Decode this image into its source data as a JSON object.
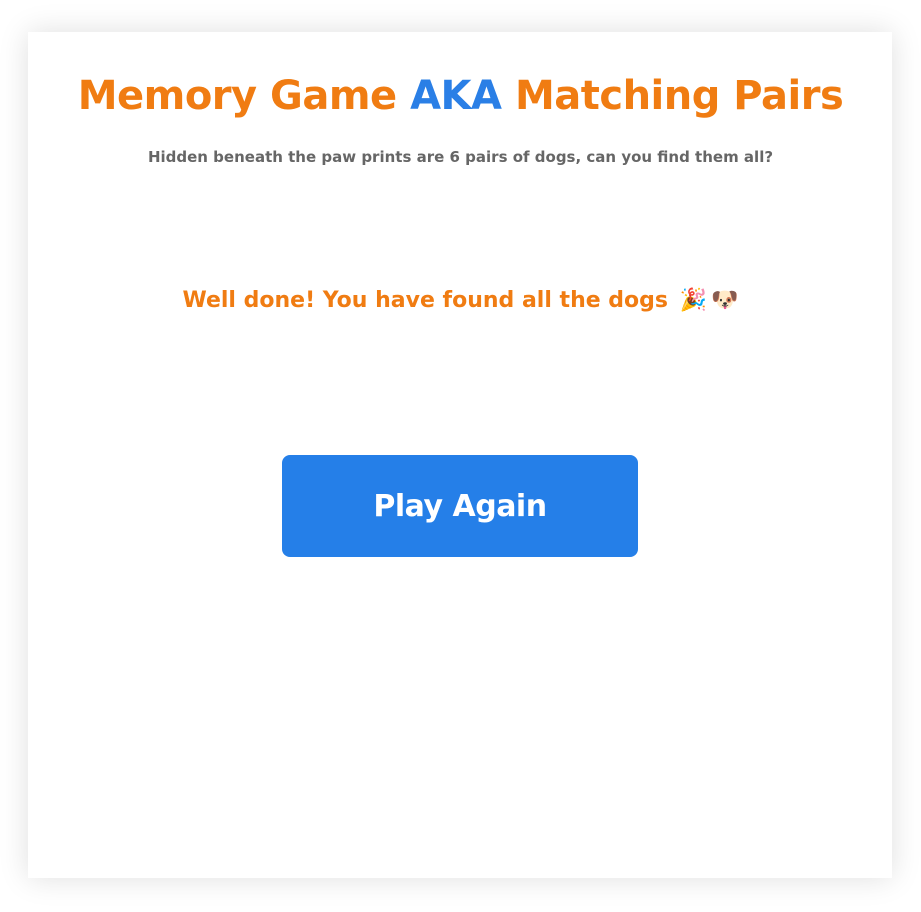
{
  "header": {
    "title_part1": "Memory Game ",
    "title_aka": "AKA",
    "title_part2": " Matching Pairs",
    "subtitle": "Hidden beneath the paw prints are 6 pairs of dogs, can you find them all?"
  },
  "result": {
    "message": "Well done! You have found all the dogs",
    "emoji_party": "🎉",
    "emoji_dog": "🐶"
  },
  "actions": {
    "play_again_label": "Play Again"
  },
  "colors": {
    "accent_orange": "#f07c12",
    "accent_blue": "#257fe8",
    "subtitle_gray": "#666666"
  },
  "icons": [
    "party-popper-icon",
    "dog-face-icon"
  ]
}
